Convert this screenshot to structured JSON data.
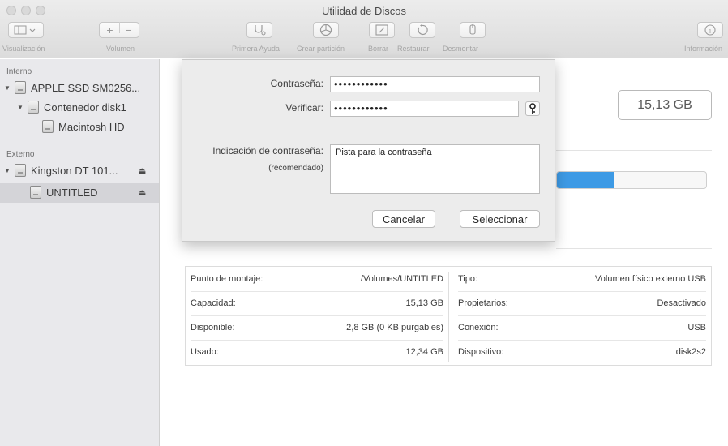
{
  "window": {
    "title": "Utilidad de Discos"
  },
  "toolbar": {
    "view_label": "Visualización",
    "volume_label": "Volumen",
    "first_aid_label": "Primera Ayuda",
    "partition_label": "Crear partición",
    "erase_label": "Borrar",
    "restore_label": "Restaurar",
    "unmount_label": "Desmontar",
    "info_label": "Información"
  },
  "sidebar": {
    "internal_header": "Interno",
    "external_header": "Externo",
    "items": [
      {
        "label": "APPLE SSD SM0256..."
      },
      {
        "label": "Contenedor disk1"
      },
      {
        "label": "Macintosh HD"
      },
      {
        "label": "Kingston DT 101..."
      },
      {
        "label": "UNTITLED"
      }
    ]
  },
  "volume": {
    "capacity_display": "15,13 GB",
    "usage_fraction": 0.38
  },
  "info": {
    "left": [
      {
        "key": "Punto de montaje:",
        "value": "/Volumes/UNTITLED"
      },
      {
        "key": "Capacidad:",
        "value": "15,13 GB"
      },
      {
        "key": "Disponible:",
        "value": "2,8 GB (0 KB purgables)"
      },
      {
        "key": "Usado:",
        "value": "12,34 GB"
      }
    ],
    "right": [
      {
        "key": "Tipo:",
        "value": "Volumen físico externo USB"
      },
      {
        "key": "Propietarios:",
        "value": "Desactivado"
      },
      {
        "key": "Conexión:",
        "value": "USB"
      },
      {
        "key": "Dispositivo:",
        "value": "disk2s2"
      }
    ]
  },
  "dialog": {
    "password_label": "Contraseña:",
    "password_value": "••••••••••••",
    "verify_label": "Verificar:",
    "verify_value": "••••••••••••",
    "hint_label": "Indicación de contraseña:",
    "hint_sublabel": "(recomendado)",
    "hint_value": "Pista para la contraseña",
    "cancel_label": "Cancelar",
    "select_label": "Seleccionar"
  },
  "colors": {
    "accent": "#3d9ae5",
    "sidebar_bg": "#e9e9ec",
    "dialog_bg": "#ececec"
  }
}
